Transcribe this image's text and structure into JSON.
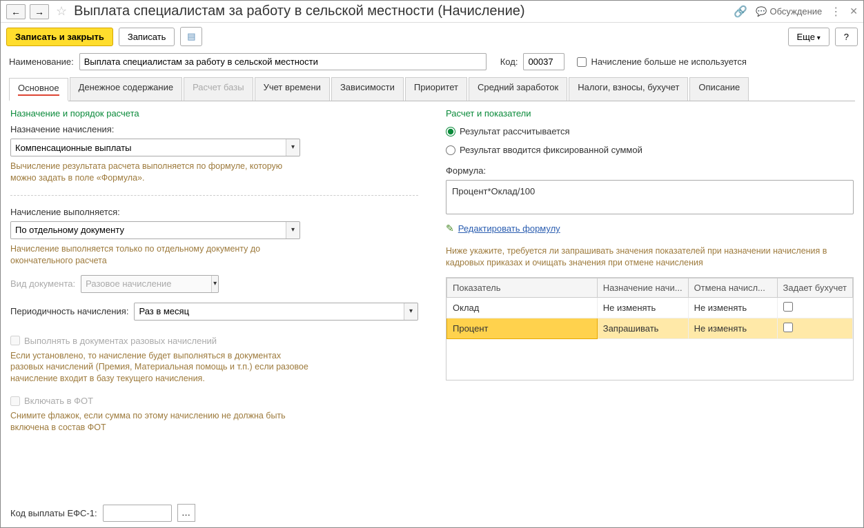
{
  "titlebar": {
    "title": "Выплата специалистам за работу в сельской местности (Начисление)",
    "discussion": "Обсуждение"
  },
  "toolbar": {
    "save_close": "Записать и закрыть",
    "save": "Записать",
    "more": "Еще",
    "help": "?"
  },
  "fields": {
    "name_label": "Наименование:",
    "name_value": "Выплата специалистам за работу в сельской местности",
    "code_label": "Код:",
    "code_value": "00037",
    "not_used_label": "Начисление больше не используется"
  },
  "tabs": [
    "Основное",
    "Денежное содержание",
    "Расчет базы",
    "Учет времени",
    "Зависимости",
    "Приоритет",
    "Средний заработок",
    "Налоги, взносы, бухучет",
    "Описание"
  ],
  "left": {
    "section1": "Назначение и порядок расчета",
    "purpose_label": "Назначение начисления:",
    "purpose_value": "Компенсационные выплаты",
    "purpose_hint": "Вычисление результата расчета выполняется по формуле, которую можно задать в поле «Формула».",
    "when_label": "Начисление выполняется:",
    "when_value": "По отдельному документу",
    "when_hint": "Начисление выполняется только по отдельному документу до окончательного расчета",
    "doc_type_label": "Вид документа:",
    "doc_type_value": "Разовое начисление",
    "period_label": "Периодичность начисления:",
    "period_value": "Раз в месяц",
    "chk_onetime": "Выполнять в документах разовых начислений",
    "chk_onetime_hint": "Если установлено, то начисление будет выполняться в документах разовых начислений (Премия, Материальная помощь и т.п.) если разовое начисление входит в базу текущего начисления.",
    "chk_fot": "Включать в ФОТ",
    "chk_fot_hint": "Снимите флажок, если сумма по этому начислению не должна быть включена в состав ФОТ"
  },
  "right": {
    "section": "Расчет и показатели",
    "radio1": "Результат рассчитывается",
    "radio2": "Результат вводится фиксированной суммой",
    "formula_label": "Формула:",
    "formula_value": "Процент*Оклад/100",
    "edit_formula": "Редактировать формулу",
    "table_hint": "Ниже укажите, требуется ли запрашивать значения показателей при назначении начисления в кадровых приказах и очищать значения при отмене начисления",
    "cols": [
      "Показатель",
      "Назначение начи...",
      "Отмена начисл...",
      "Задает бухучет"
    ],
    "rows": [
      {
        "ind": "Оклад",
        "assign": "Не изменять",
        "cancel": "Не изменять",
        "acc": false
      },
      {
        "ind": "Процент",
        "assign": "Запрашивать",
        "cancel": "Не изменять",
        "acc": false
      }
    ]
  },
  "footer": {
    "efs_label": "Код выплаты ЕФС-1:"
  }
}
